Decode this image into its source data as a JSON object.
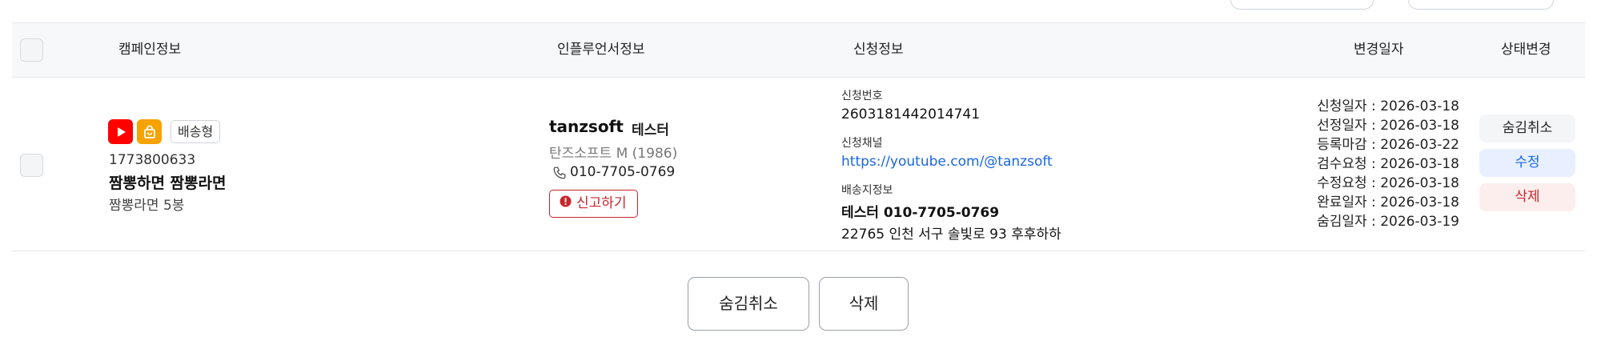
{
  "header": {
    "campaign_info": "캠페인정보",
    "influencer_info": "인플루언서정보",
    "application_info": "신청정보",
    "change_date": "변경일자",
    "status_change": "상태변경"
  },
  "row": {
    "badge_type": "배송형",
    "campaign_id": "1773800633",
    "campaign_title": "짬뽕하면 짬뽕라면",
    "campaign_subtitle": "짬뽕라면 5봉",
    "influencer_id": "tanzsoft",
    "influencer_name": "테스터",
    "influencer_detail": "탄즈소프트 M (1986)",
    "influencer_phone": "010-7705-0769",
    "report_label": "신고하기",
    "app_no_label": "신청번호",
    "app_no": "2603181442014741",
    "channel_label": "신청채널",
    "channel_url": "https://youtube.com/@tanzsoft",
    "shipping_label": "배송지정보",
    "shipping_name_phone": "테스터 010-7705-0769",
    "shipping_address": "22765 인천 서구 솔빛로 93 후후하하",
    "dates": [
      "신청일자 : 2026-03-18",
      "선정일자 : 2026-03-18",
      "등록마감 : 2026-03-22",
      "검수요청 : 2026-03-18",
      "수정요청 : 2026-03-18",
      "완료일자 : 2026-03-18",
      "숨김일자 : 2026-03-19"
    ],
    "status_buttons": [
      "숨김취소",
      "수정",
      "삭제"
    ]
  },
  "footer": {
    "unhide_label": "숨김취소",
    "delete_label": "삭제"
  },
  "colors": {
    "accent_blue": "#1a66e0",
    "danger_red": "#c9252c",
    "youtube_red": "#ff0000",
    "shop_orange": "#f5a300"
  }
}
